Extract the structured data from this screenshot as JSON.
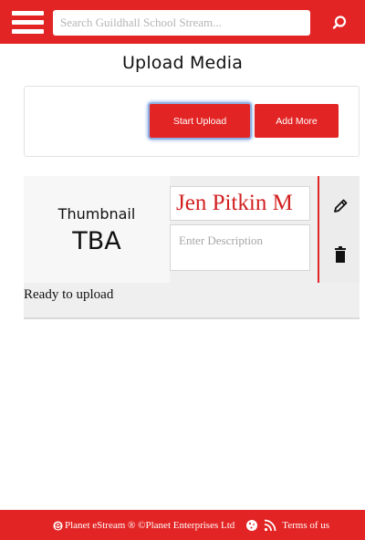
{
  "header": {
    "search_placeholder": "Search Guildhall School Stream...",
    "menu_icon": "hamburger-icon",
    "search_icon": "search-icon"
  },
  "page": {
    "title": "Upload Media"
  },
  "upload_panel": {
    "start_label": "Start Upload",
    "add_more_label": "Add More"
  },
  "media_item": {
    "thumbnail_label": "Thumbnail",
    "thumbnail_value": "TBA",
    "title_value": "Jen Pitkin M",
    "description_placeholder": "Enter Description",
    "status": "Ready to upload",
    "edit_icon": "pencil-icon",
    "delete_icon": "trash-icon"
  },
  "footer": {
    "brand": "Planet eStream ® ©Planet Enterprises Ltd",
    "terms": "Terms of us",
    "logo_icon": "planet-estream-logo-icon",
    "icons": [
      "cookie-icon",
      "rss-icon"
    ]
  },
  "colors": {
    "accent": "#e32424",
    "focus_ring": "#8fb1e6",
    "title_text": "#d22020"
  }
}
